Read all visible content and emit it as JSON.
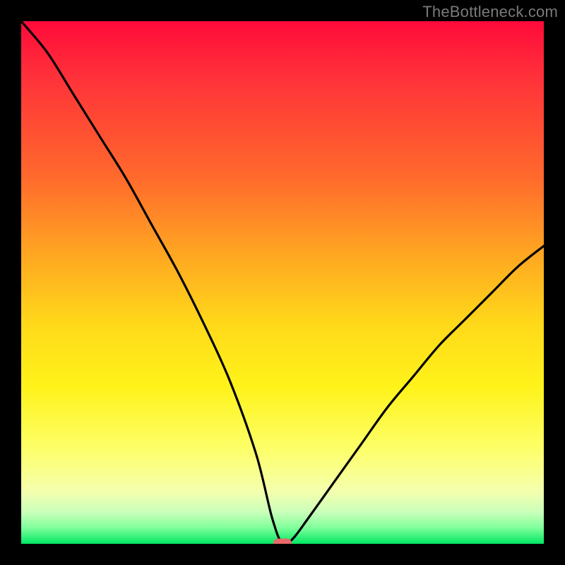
{
  "watermark": "TheBottleneck.com",
  "chart_data": {
    "type": "line",
    "title": "",
    "xlabel": "",
    "ylabel": "",
    "xlim": [
      0,
      100
    ],
    "ylim": [
      0,
      100
    ],
    "series": [
      {
        "name": "bottleneck-curve",
        "x": [
          0,
          5,
          10,
          15,
          20,
          25,
          30,
          35,
          40,
          45,
          48,
          50,
          52,
          55,
          60,
          65,
          70,
          75,
          80,
          85,
          90,
          95,
          100
        ],
        "values": [
          100,
          94,
          86,
          78,
          70,
          61,
          52,
          42,
          31,
          17,
          5,
          0,
          1,
          5,
          12,
          19,
          26,
          32,
          38,
          43,
          48,
          53,
          57
        ]
      }
    ],
    "marker": {
      "name": "optimal-point",
      "x": 50,
      "y": 0,
      "color": "#e76a6a",
      "width_frac": 0.035,
      "height_frac": 0.018
    },
    "gradient_stops": [
      {
        "pos": 0.0,
        "color": "#ff0a3a"
      },
      {
        "pos": 0.1,
        "color": "#ff2f3a"
      },
      {
        "pos": 0.3,
        "color": "#ff6a2c"
      },
      {
        "pos": 0.45,
        "color": "#ffa821"
      },
      {
        "pos": 0.58,
        "color": "#ffd91a"
      },
      {
        "pos": 0.7,
        "color": "#fff31a"
      },
      {
        "pos": 0.82,
        "color": "#fdff6a"
      },
      {
        "pos": 0.9,
        "color": "#f4ffae"
      },
      {
        "pos": 0.94,
        "color": "#c9ffba"
      },
      {
        "pos": 0.97,
        "color": "#7dff9a"
      },
      {
        "pos": 1.0,
        "color": "#00e763"
      }
    ]
  }
}
